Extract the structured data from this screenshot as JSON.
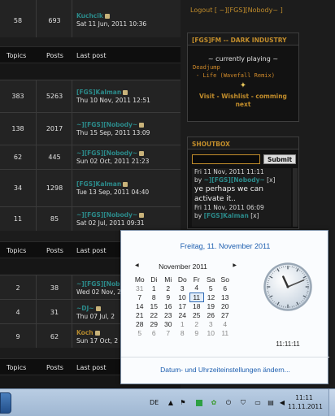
{
  "forum": {
    "headers": {
      "topics": "Topics",
      "posts": "Posts",
      "last_post": "Last post"
    },
    "section1_rows": [
      {
        "topics": "58",
        "posts": "693",
        "user": "Kuchcik",
        "user_color": "#2b8a8a",
        "date": "Sat 11 Jun, 2011 10:36"
      }
    ],
    "section2_rows": [
      {
        "topics": "383",
        "posts": "5263",
        "user": "[FGS]Kalman",
        "user_color": "#2b8a8a",
        "date": "Thu 10 Nov, 2011 12:51"
      },
      {
        "topics": "138",
        "posts": "2017",
        "user": "~][FGS][Nobody~",
        "user_color": "#2b8a8a",
        "date": "Thu 15 Sep, 2011 13:09"
      },
      {
        "topics": "62",
        "posts": "445",
        "user": "~][FGS][Nobody~",
        "user_color": "#2b8a8a",
        "date": "Sun 02 Oct, 2011 21:23"
      },
      {
        "topics": "34",
        "posts": "1298",
        "user": "[FGS]Kalman",
        "user_color": "#2b8a8a",
        "date": "Tue 13 Sep, 2011 04:40"
      },
      {
        "topics": "11",
        "posts": "85",
        "user": "~][FGS][Nobody~",
        "user_color": "#2b8a8a",
        "date": "Sat 02 Jul, 2011 09:31"
      }
    ],
    "section3_rows": [
      {
        "topics": "2",
        "posts": "38",
        "user": "~][FGS][Nob",
        "user_color": "#2b8a8a",
        "date": "Wed 02 Nov, 2"
      },
      {
        "topics": "4",
        "posts": "31",
        "user": "~DJ~",
        "user_color": "#2b8a8a",
        "date": "Thu 07 Jul, 2"
      },
      {
        "topics": "9",
        "posts": "62",
        "user": "Koch",
        "user_color": "#b3882d",
        "date": "Sun 17 Oct, 2"
      }
    ]
  },
  "sidebar": {
    "logout": "Logout [ ~][FGS][Nobody~ ]",
    "fm": {
      "title": "[FGS]FM -- DARK INDUSTRY",
      "now_playing": "~ currently playing ~",
      "track1": "Deadjump",
      "track2": "- Life (Wavefall Remix)",
      "links": "Visit - Wishlist - comming next"
    },
    "shoutbox": {
      "title": "SHOUTBOX",
      "submit": "Submit",
      "input_value": "",
      "messages": [
        {
          "date": "Fri 11 Nov, 2011 11:11",
          "by": "by",
          "user": "~][FGS][Nobody~",
          "close": "[x]",
          "text": "ye perhaps we can activate it.."
        },
        {
          "date": "Fri 11 Nov, 2011 06:09",
          "by": "by",
          "user": "[FGS]Kalman",
          "close": "[x]",
          "text": ""
        }
      ]
    }
  },
  "calendar": {
    "header_date": "Freitag, 11. November 2011",
    "month_label": "November 2011",
    "prev": "◀",
    "next": "▶",
    "weekdays": [
      "Mo",
      "Di",
      "Mi",
      "Do",
      "Fr",
      "Sa",
      "So"
    ],
    "weeks": [
      [
        "31",
        "1",
        "2",
        "3",
        "4",
        "5",
        "6"
      ],
      [
        "7",
        "8",
        "9",
        "10",
        "11",
        "12",
        "13"
      ],
      [
        "14",
        "15",
        "16",
        "17",
        "18",
        "19",
        "20"
      ],
      [
        "21",
        "22",
        "23",
        "24",
        "25",
        "26",
        "27"
      ],
      [
        "28",
        "29",
        "30",
        "1",
        "2",
        "3",
        "4"
      ],
      [
        "5",
        "6",
        "7",
        "8",
        "9",
        "10",
        "11"
      ]
    ],
    "today": "11",
    "time": "11:11:11",
    "clock_hour": 11,
    "clock_minute": 11,
    "clock_second": 11,
    "settings_link": "Datum- und Uhrzeiteinstellungen ändern..."
  },
  "taskbar": {
    "language": "DE",
    "time": "11:11",
    "date": "11.11.2011",
    "tray_icons": [
      "show-hidden-icon",
      "flag-icon",
      "green-square-icon",
      "gear-flower-icon",
      "power-icon",
      "shield-icon",
      "monitor-icon",
      "network-icon",
      "volume-icon"
    ]
  }
}
